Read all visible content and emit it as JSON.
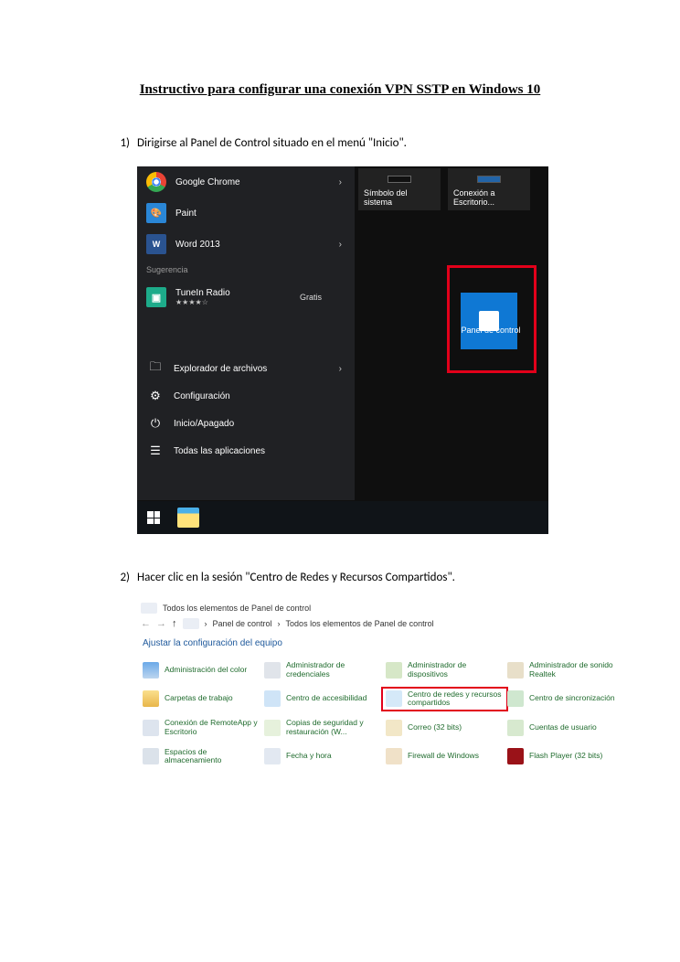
{
  "title": "Instructivo para configurar una conexión VPN SSTP en Windows 10",
  "steps": [
    {
      "num": "1)",
      "text": "Dirigirse al Panel de Control situado en el menú \"Inicio\"."
    },
    {
      "num": "2)",
      "text": "Hacer clic en la sesión \"Centro de Redes y Recursos Compartidos\"."
    }
  ],
  "start_menu": {
    "most_used": [
      {
        "label": "Google Chrome",
        "icon": "chrome",
        "chevron": true
      },
      {
        "label": "Paint",
        "icon": "paint",
        "chevron": false
      },
      {
        "label": "Word 2013",
        "icon": "word",
        "chevron": true,
        "badge": "W"
      }
    ],
    "suggestion_header": "Sugerencia",
    "suggestion": {
      "label": "TuneIn Radio",
      "price": "Gratis",
      "stars": "★★★★☆"
    },
    "system": [
      {
        "label": "Explorador de archivos",
        "chevron": true,
        "icon": "explorer"
      },
      {
        "label": "Configuración",
        "icon": "gear"
      },
      {
        "label": "Inicio/Apagado",
        "icon": "power"
      },
      {
        "label": "Todas las aplicaciones",
        "icon": "allapps"
      }
    ],
    "tiles": {
      "system_symbol": "Símbolo del sistema",
      "remote_desktop": "Conexión a Escritorio...",
      "control_panel": "Panel de control"
    }
  },
  "control_panel": {
    "window_title": "Todos los elementos de Panel de control",
    "breadcrumb": [
      "Panel de control",
      "Todos los elementos de Panel de control"
    ],
    "subheader": "Ajustar la configuración del equipo",
    "items": [
      "Administración del color",
      "Administrador de credenciales",
      "Administrador de dispositivos",
      "Administrador de sonido Realtek",
      "Carpetas de trabajo",
      "Centro de accesibilidad",
      "Centro de redes y recursos compartidos",
      "Centro de sincronización",
      "Conexión de RemoteApp y Escritorio",
      "Copias de seguridad y restauración (W...",
      "Correo (32 bits)",
      "Cuentas de usuario",
      "Espacios de almacenamiento",
      "Fecha y hora",
      "Firewall de Windows",
      "Flash Player (32 bits)"
    ],
    "highlight_index": 6
  }
}
